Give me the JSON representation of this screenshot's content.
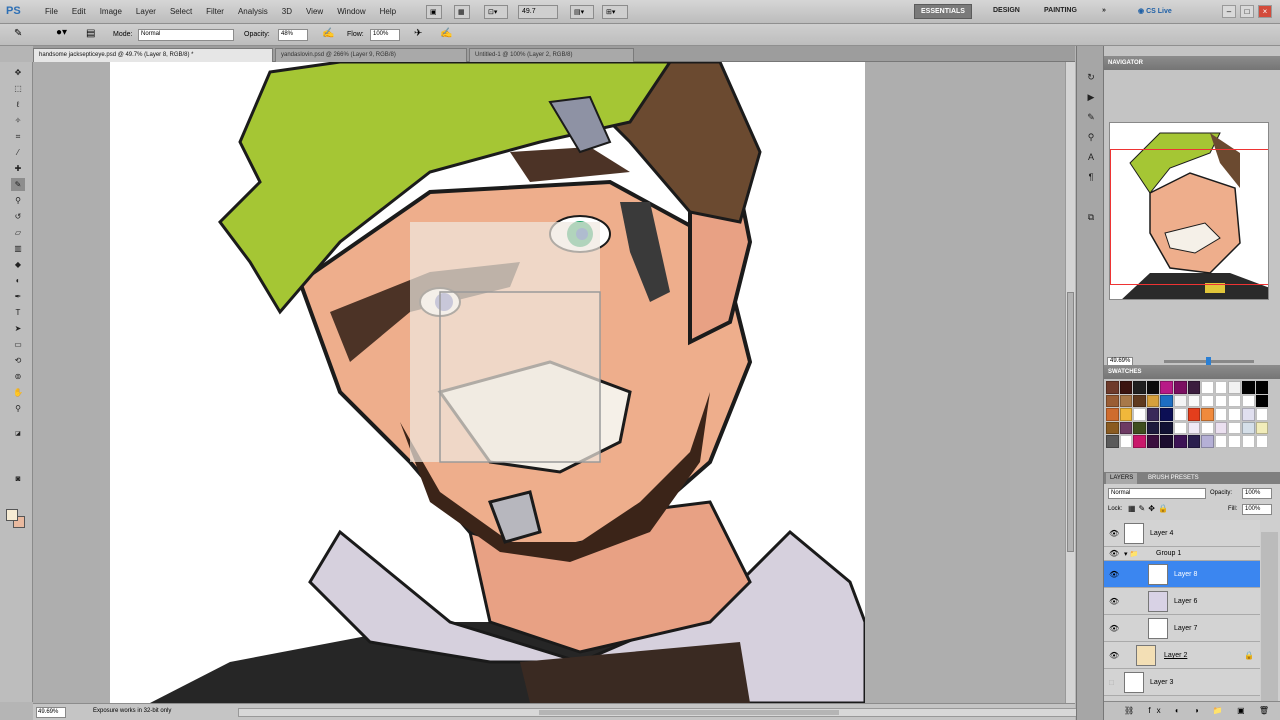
{
  "app": {
    "logo": "PS"
  },
  "menu": [
    "File",
    "Edit",
    "Image",
    "Layer",
    "Select",
    "Filter",
    "Analysis",
    "3D",
    "View",
    "Window",
    "Help"
  ],
  "menubar": {
    "zoom": "49.7",
    "workspaces": [
      "ESSENTIALS",
      "DESIGN",
      "PAINTING"
    ],
    "more": "»",
    "cs_live": "CS Live"
  },
  "options": {
    "mode_label": "Mode:",
    "mode_value": "Normal",
    "opacity_label": "Opacity:",
    "opacity_value": "48%",
    "flow_label": "Flow:",
    "flow_value": "100%"
  },
  "tabs": [
    {
      "label": "handsome jacksepticeye.psd @ 49.7% (Layer 8, RGB/8) *"
    },
    {
      "label": "yandaslovin.psd @ 266% (Layer 9, RGB/8)"
    },
    {
      "label": "Untitled-1 @ 100% (Layer 2, RGB/8)"
    }
  ],
  "status": {
    "zoom": "49.69%",
    "info": "Exposure works in 32-bit only"
  },
  "panels": {
    "navigator": {
      "title": "NAVIGATOR",
      "zoom": "49.69%"
    },
    "swatches": {
      "title": "SWATCHES",
      "colors": [
        "#6e3a2a",
        "#3b1410",
        "#1f1f1f",
        "#0c0c0c",
        "#b81a87",
        "#7b0f61",
        "#3b1d3e",
        "#ffffff",
        "#ffffff",
        "#f2f2f2",
        "#000000",
        "#000000",
        "#9a5d34",
        "#a87949",
        "#5f3a1f",
        "#d6a03c",
        "#1d6ec2",
        "#f4f4f4",
        "#f9f9f9",
        "#ffffff",
        "#ffffff",
        "#ffffff",
        "#ffffff",
        "#000000",
        "#cf6c2e",
        "#f0b83b",
        "#ffffff",
        "#3a2a59",
        "#0c0f55",
        "#ffffff",
        "#e43e1c",
        "#f08a3c",
        "#ffffff",
        "#ffffff",
        "#e0dfef",
        "#ffffff",
        "#8a5b21",
        "#6d3a63",
        "#3e4e1e",
        "#1c1a3c",
        "#111133",
        "#ffffff",
        "#f0eaf6",
        "#ffffff",
        "#ebe0f0",
        "#ffffff",
        "#d5dfe9",
        "#f2edba",
        "#5a5a5a",
        "#ffffff",
        "#c9186b",
        "#3b0f3e",
        "#1b0c2e",
        "#3d1355",
        "#2a1f4e",
        "#b5b0d6",
        "#ffffff",
        "#ffffff",
        "#ffffff",
        "#ffffff"
      ]
    },
    "layers": {
      "tab_layers": "LAYERS",
      "tab_brushes": "BRUSH PRESETS",
      "blend": "Normal",
      "opacity_label": "Opacity:",
      "opacity_value": "100%",
      "lock_label": "Lock:",
      "fill_label": "Fill:",
      "fill_value": "100%",
      "items": [
        {
          "name": "Layer 4"
        },
        {
          "name": "Group 1"
        },
        {
          "name": "Layer 8"
        },
        {
          "name": "Layer 6"
        },
        {
          "name": "Layer 7"
        },
        {
          "name": "Layer 2"
        },
        {
          "name": "Layer 3"
        }
      ]
    }
  }
}
